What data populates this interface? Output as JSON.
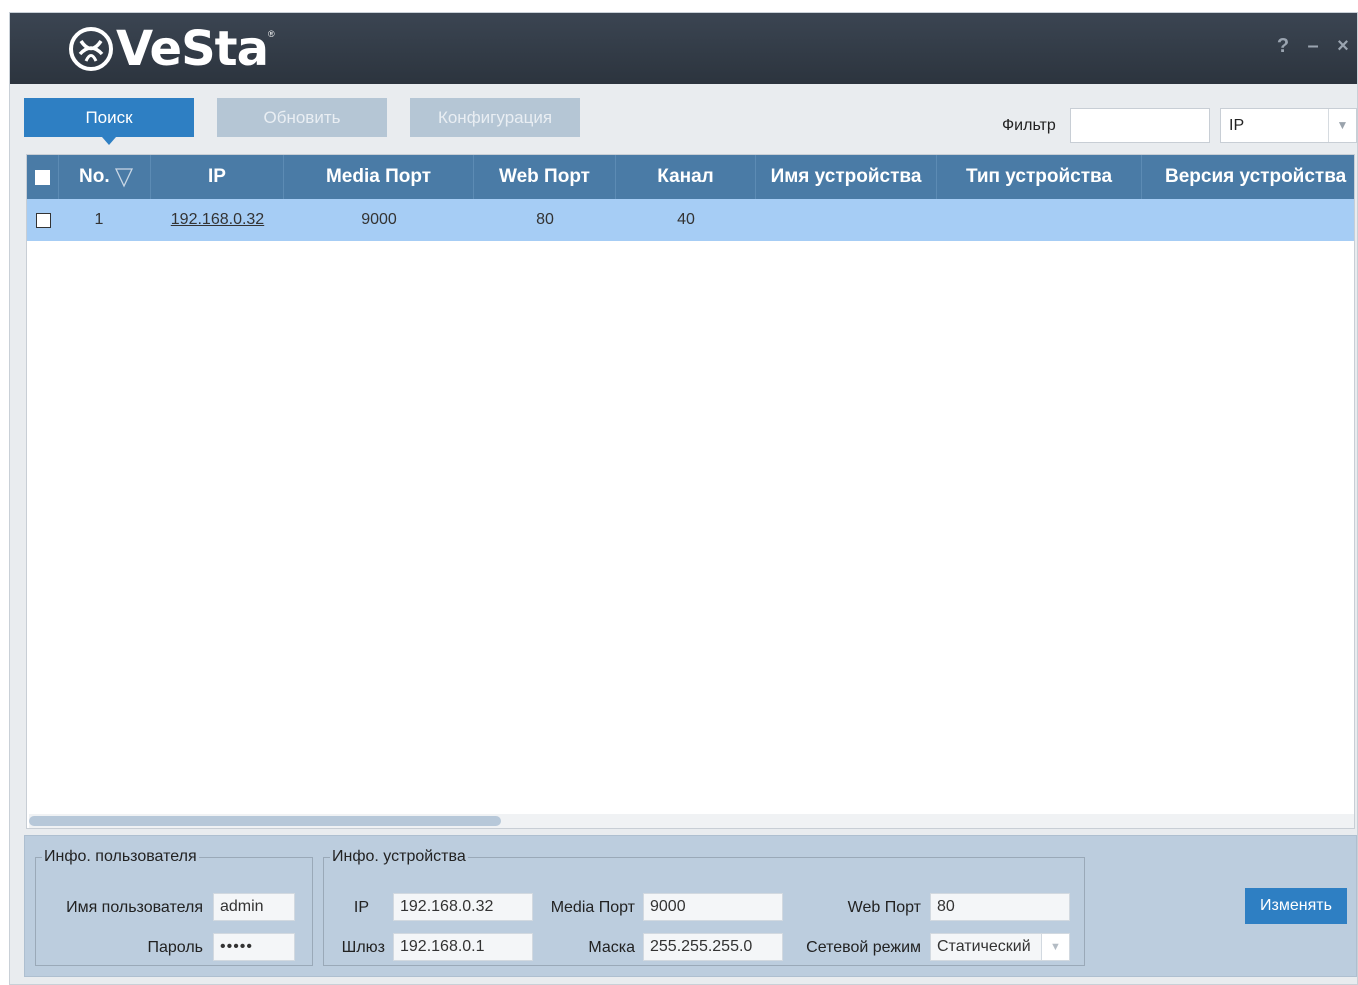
{
  "brand": {
    "name": "VeSta",
    "reg": "®"
  },
  "window_controls": {
    "help": "?",
    "minimize": "–",
    "close": "×"
  },
  "toolbar": {
    "search_label": "Поиск",
    "refresh_label": "Обновить",
    "config_label": "Конфигурация",
    "filter_label": "Фильтр",
    "filter_value": "",
    "filter_type": "IP"
  },
  "table": {
    "columns": [
      "No.",
      "IP",
      "Media Порт",
      "Web Порт",
      "Канал",
      "Имя устройства",
      "Тип устройства",
      "Версия устройства"
    ],
    "rows": [
      {
        "no": "1",
        "ip": "192.168.0.32",
        "media_port": "9000",
        "web_port": "80",
        "channel": "40",
        "device_name": "",
        "device_type": "",
        "device_version": ""
      }
    ]
  },
  "user_info": {
    "legend": "Инфо. пользователя",
    "username_label": "Имя пользователя",
    "username_value": "admin",
    "password_label": "Пароль",
    "password_value": "•••••"
  },
  "device_info": {
    "legend": "Инфо. устройства",
    "ip_label": "IP",
    "ip_value": "192.168.0.32",
    "media_port_label": "Media Порт",
    "media_port_value": "9000",
    "web_port_label": "Web Порт",
    "web_port_value": "80",
    "gateway_label": "Шлюз",
    "gateway_value": "192.168.0.1",
    "mask_label": "Маска",
    "mask_value": "255.255.255.0",
    "net_mode_label": "Сетевой режим",
    "net_mode_value": "Статический"
  },
  "modify_label": "Изменять",
  "colors": {
    "accent": "#2e7fc3",
    "header": "#4a7ba6",
    "selected_row": "#a6cdf5",
    "titlebar": "#2f3843"
  }
}
